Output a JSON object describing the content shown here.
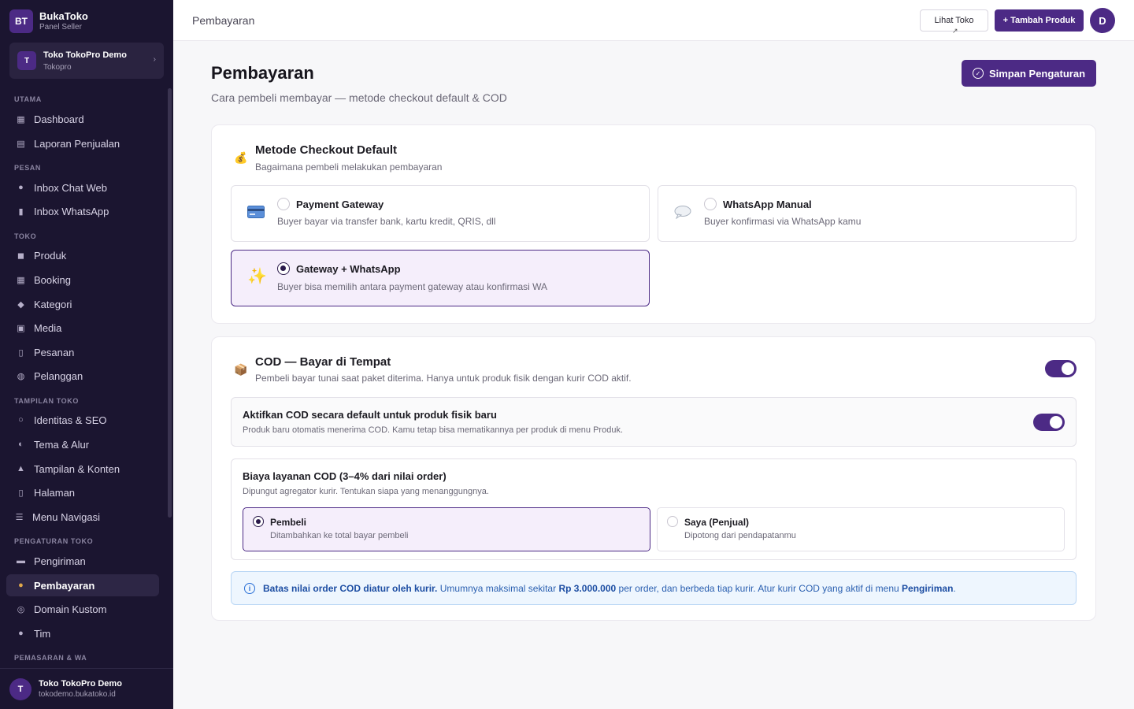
{
  "brand": {
    "logo": "BT",
    "name": "BukaToko",
    "sub": "Panel Seller"
  },
  "store": {
    "avatar": "T",
    "name": "Toko TokoPro Demo",
    "sub": "Tokopro"
  },
  "nav": {
    "sections": {
      "utama": "UTAMA",
      "pesan": "PESAN",
      "toko": "TOKO",
      "tampilan": "TAMPILAN TOKO",
      "pengaturan": "PENGATURAN TOKO",
      "pemasaran": "PEMASARAN & WA"
    },
    "items": {
      "dashboard": "Dashboard",
      "laporan": "Laporan Penjualan",
      "inbox_web": "Inbox Chat Web",
      "inbox_wa": "Inbox WhatsApp",
      "produk": "Produk",
      "booking": "Booking",
      "kategori": "Kategori",
      "media": "Media",
      "pesanan": "Pesanan",
      "pelanggan": "Pelanggan",
      "identitas": "Identitas & SEO",
      "tema": "Tema & Alur",
      "tampilan": "Tampilan & Konten",
      "halaman": "Halaman",
      "menu": "Menu Navigasi",
      "pengiriman": "Pengiriman",
      "pembayaran": "Pembayaran",
      "domain": "Domain Kustom",
      "tim": "Tim"
    }
  },
  "footer": {
    "avatar": "T",
    "name": "Toko TokoPro Demo",
    "sub": "tokodemo.bukatoko.id"
  },
  "topbar": {
    "breadcrumb": "Pembayaran",
    "view_store": "Lihat Toko",
    "add_product": "+ Tambah Produk",
    "avatar": "D"
  },
  "page": {
    "title": "Pembayaran",
    "subtitle": "Cara pembeli membayar — metode checkout default & COD",
    "save": "Simpan Pengaturan"
  },
  "checkout": {
    "title": "Metode Checkout Default",
    "sub": "Bagaimana pembeli melakukan pembayaran",
    "options": [
      {
        "title": "Payment Gateway",
        "sub": "Buyer bayar via transfer bank, kartu kredit, QRIS, dll",
        "selected": false
      },
      {
        "title": "WhatsApp Manual",
        "sub": "Buyer konfirmasi via WhatsApp kamu",
        "selected": false
      },
      {
        "title": "Gateway + WhatsApp",
        "sub": "Buyer bisa memilih antara payment gateway atau konfirmasi WA",
        "selected": true
      }
    ]
  },
  "cod": {
    "title": "COD — Bayar di Tempat",
    "sub": "Pembeli bayar tunai saat paket diterima. Hanya untuk produk fisik dengan kurir COD aktif.",
    "enabled": true,
    "default_title": "Aktifkan COD secara default untuk produk fisik baru",
    "default_sub": "Produk baru otomatis menerima COD. Kamu tetap bisa mematikannya per produk di menu Produk.",
    "default_enabled": true,
    "fee_title": "Biaya layanan COD (3–4% dari nilai order)",
    "fee_sub": "Dipungut agregator kurir. Tentukan siapa yang menanggungnya.",
    "fee_options": [
      {
        "title": "Pembeli",
        "sub": "Ditambahkan ke total bayar pembeli",
        "selected": true
      },
      {
        "title": "Saya (Penjual)",
        "sub": "Dipotong dari pendapatanmu",
        "selected": false
      }
    ],
    "info": {
      "bold1": "Batas nilai order COD diatur oleh kurir.",
      "text1": "Umumnya maksimal sekitar",
      "bold2": "Rp 3.000.000",
      "text2": "per order, dan berbeda tiap kurir. Atur kurir COD yang aktif di menu",
      "bold3": "Pengiriman",
      "text3": "."
    }
  },
  "colors": {
    "brand": "#4c2a85",
    "sidebar": "#1b1530",
    "info": "#2a5fb0"
  }
}
